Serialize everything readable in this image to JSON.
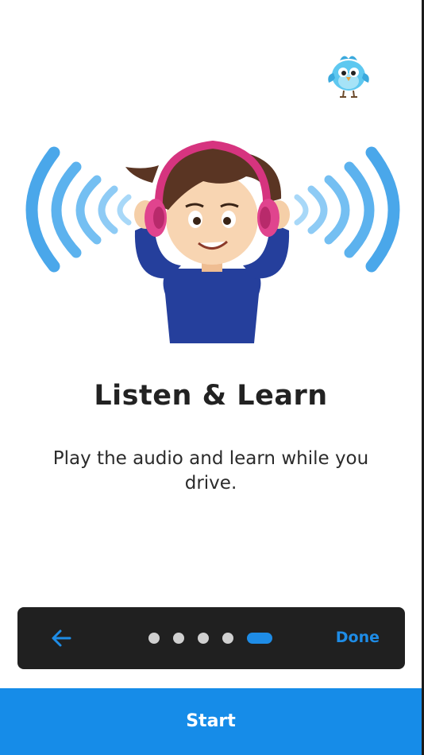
{
  "onboarding": {
    "title": "Listen & Learn",
    "description": "Play the audio and learn while you drive."
  },
  "pager": {
    "back_icon": "arrow-left-icon",
    "done_label": "Done",
    "page_count": 5,
    "current_page": 5
  },
  "start_button": {
    "label": "Start"
  },
  "colors": {
    "accent": "#1E8CE6",
    "start_button": "#168CE8",
    "pager_background": "#202020",
    "dot_inactive": "#D0D0D0",
    "title_text": "#222222"
  },
  "icons": {
    "mascot": "blue-bird-mascot-icon",
    "illustration": "boy-with-headphones-illustration"
  }
}
